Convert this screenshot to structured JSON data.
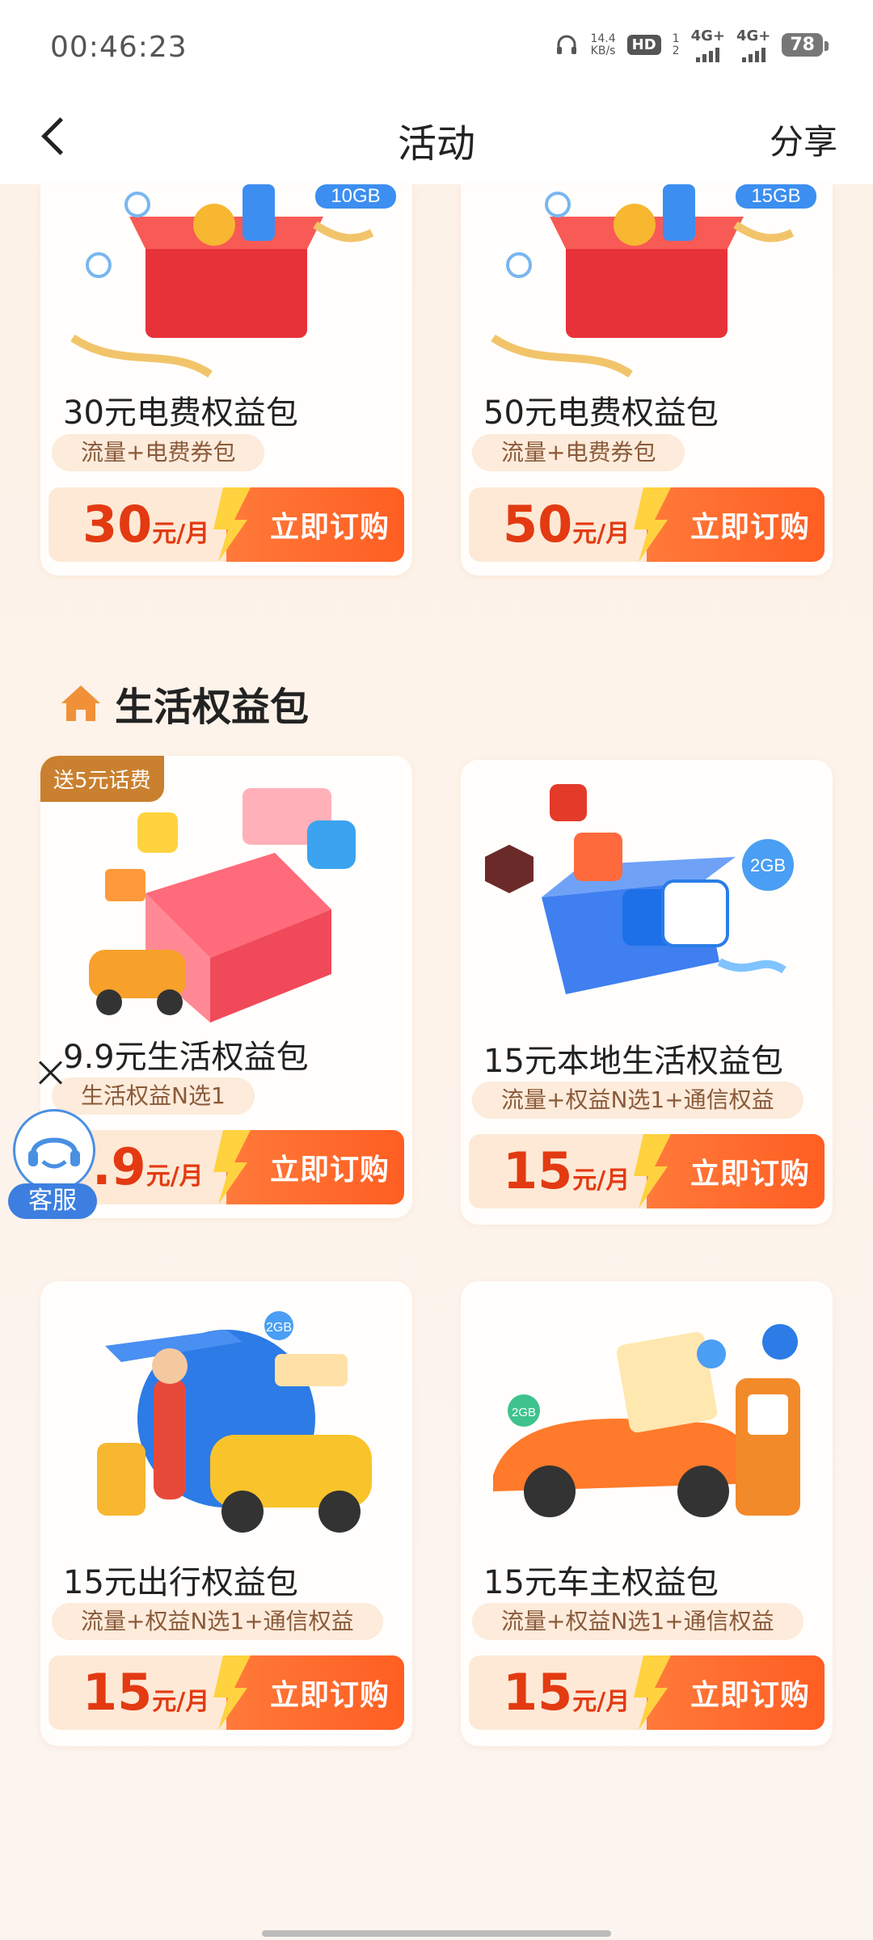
{
  "status": {
    "time": "00:46:23",
    "speed_value": "14.4",
    "speed_unit": "KB/s",
    "hd": "HD",
    "sim1": "1",
    "sim2": "2",
    "net1": "4G+",
    "net2": "4G+",
    "battery": "78"
  },
  "nav": {
    "title": "活动",
    "share": "分享"
  },
  "section": {
    "title": "生活权益包"
  },
  "cards": [
    {
      "title": "30元电费权益包",
      "tag": "流量+电费券包",
      "price": "30",
      "unit": "元/月",
      "button": "立即订购",
      "art_label": "10GB"
    },
    {
      "title": "50元电费权益包",
      "tag": "流量+电费券包",
      "price": "50",
      "unit": "元/月",
      "button": "立即订购",
      "art_label": "15GB"
    },
    {
      "title": "9.9元生活权益包",
      "tag": "生活权益N选1",
      "price": ".9",
      "unit": "元/月",
      "button": "立即订购",
      "badge": "送5元话费"
    },
    {
      "title": "15元本地生活权益包",
      "tag": "流量+权益N选1+通信权益",
      "price": "15",
      "unit": "元/月",
      "button": "立即订购",
      "art_label": "2GB"
    },
    {
      "title": "15元出行权益包",
      "tag": "流量+权益N选1+通信权益",
      "price": "15",
      "unit": "元/月",
      "button": "立即订购",
      "art_label": "2GB"
    },
    {
      "title": "15元车主权益包",
      "tag": "流量+权益N选1+通信权益",
      "price": "15",
      "unit": "元/月",
      "button": "立即订购",
      "art_label": "2GB"
    }
  ],
  "customer_service": {
    "label": "客服"
  }
}
